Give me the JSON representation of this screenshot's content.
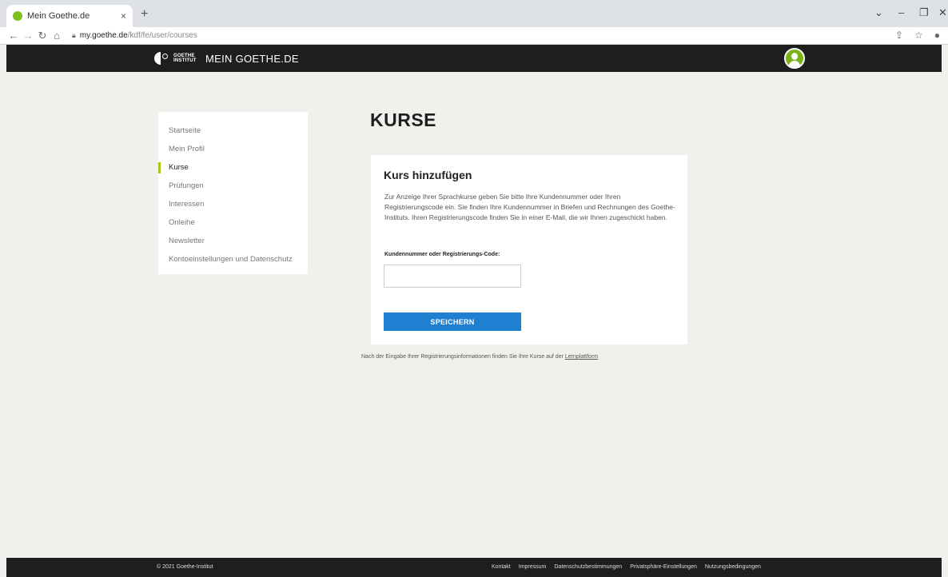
{
  "browser": {
    "tab_title": "Mein Goethe.de",
    "tab_close": "×",
    "new_tab": "+",
    "url_host": "my.goethe.de",
    "url_path": "/kdf/fe/user/courses",
    "controls": {
      "minimize": "–",
      "restore": "❐",
      "close": "✕",
      "menu": "⌄"
    }
  },
  "header": {
    "institute": "GOETHE INSTITUT",
    "title": "MEIN GOETHE.DE"
  },
  "sidebar": {
    "items": [
      {
        "label": "Startseite",
        "active": false
      },
      {
        "label": "Mein Profil",
        "active": false
      },
      {
        "label": "Kurse",
        "active": true
      },
      {
        "label": "Prüfungen",
        "active": false
      },
      {
        "label": "Interessen",
        "active": false
      },
      {
        "label": "Onleihe",
        "active": false
      },
      {
        "label": "Newsletter",
        "active": false
      },
      {
        "label": "Kontoeinstellungen und Datenschutz",
        "active": false
      }
    ]
  },
  "main": {
    "title": "KURSE",
    "card": {
      "title": "Kurs hinzufügen",
      "description": "Zur Anzeige Ihrer Sprachkurse geben Sie bitte Ihre Kundennummer oder Ihren Registrierungscode ein. Sie finden Ihre Kundennummer in Briefen und Rechnungen des Goethe-Instituts. Ihren Registrierungscode finden Sie in einer E-Mail, die wir Ihnen zugeschickt haben.",
      "field_label": "Kundennummer oder Registrierungs-Code:",
      "field_value": "",
      "button_label": "SPEICHERN"
    },
    "note_text": "Nach der Eingabe Ihrer Registrierungsinformationen finden Sie Ihre Kurse auf der ",
    "note_link": "Lernplattform"
  },
  "footer": {
    "copyright": "© 2021 Goethe-Institut",
    "links": [
      "Kontakt",
      "Impressum",
      "Datenschutzbestimmungen",
      "Privatsphäre-Einstellungen",
      "Nutzungsbedingungen"
    ]
  },
  "colors": {
    "accent": "#a0c814",
    "button": "#1f7fd1",
    "header_bg": "#1e1e1e",
    "page_bg": "#f0f0ec",
    "avatar": "#7ab317"
  }
}
